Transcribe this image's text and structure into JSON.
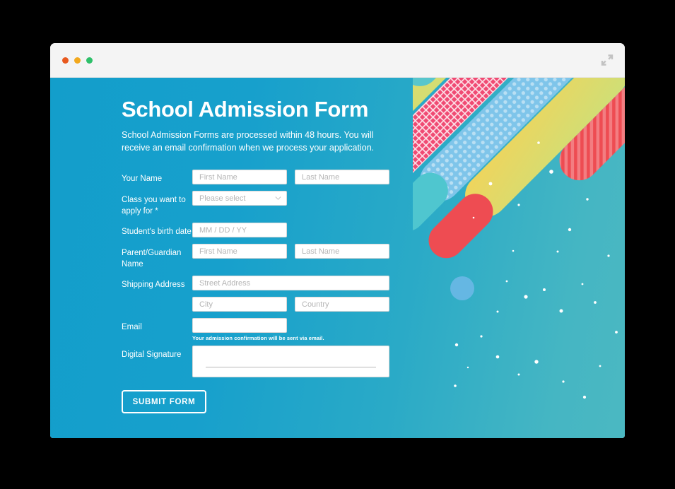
{
  "window": {
    "traffic_lights": [
      {
        "name": "close",
        "color": "#e8591f"
      },
      {
        "name": "minimize",
        "color": "#f2a81d"
      },
      {
        "name": "maximize",
        "color": "#2ec06a"
      }
    ],
    "expand_icon": "fullscreen-expand-icon"
  },
  "header": {
    "title": "School Admission Form",
    "subtitle": "School Admission Forms are processed within 48 hours. You will receive an email confirmation when we process your application."
  },
  "form": {
    "rows": [
      {
        "label": "Your Name",
        "fields": [
          {
            "name": "first-name-input",
            "placeholder": "First Name",
            "value": "",
            "width": "short"
          },
          {
            "name": "last-name-input",
            "placeholder": "Last Name",
            "value": "",
            "width": "short"
          }
        ]
      },
      {
        "label": "Class you want to apply for *",
        "fields": [
          {
            "name": "class-select",
            "placeholder": "Please select",
            "value": "",
            "width": "short",
            "type": "select"
          }
        ]
      },
      {
        "label": "Student's birth date",
        "fields": [
          {
            "name": "birth-date-input",
            "placeholder": "MM / DD / YY",
            "value": "",
            "width": "short"
          }
        ]
      },
      {
        "label": "Parent/Guardian Name",
        "fields": [
          {
            "name": "guardian-first-name-input",
            "placeholder": "First Name",
            "value": "",
            "width": "short"
          },
          {
            "name": "guardian-last-name-input",
            "placeholder": "Last Name",
            "value": "",
            "width": "short"
          }
        ]
      },
      {
        "label": "Shipping Address",
        "fields": [
          {
            "name": "street-address-input",
            "placeholder": "Street Address",
            "value": "",
            "width": "wide"
          }
        ]
      },
      {
        "label": "",
        "fields": [
          {
            "name": "city-input",
            "placeholder": "City",
            "value": "",
            "width": "short"
          },
          {
            "name": "country-input",
            "placeholder": "Country",
            "value": "",
            "width": "short"
          }
        ]
      },
      {
        "label": "Email",
        "helper": "Your admission confirmation will be sent via email.",
        "fields": [
          {
            "name": "email-input",
            "placeholder": "",
            "value": "",
            "width": "short"
          }
        ]
      },
      {
        "label": "Digital Signature",
        "fields": [
          {
            "name": "digital-signature-pad",
            "placeholder": "",
            "value": "",
            "width": "wide",
            "type": "signature"
          }
        ]
      }
    ],
    "submit_label": "SUBMIT FORM"
  },
  "colors": {
    "gradient_start": "#139ECB",
    "gradient_end": "#4BB8C2",
    "accent_pink": "#F04A73",
    "accent_yellow": "#F2C94C",
    "accent_lime": "#D6E06B",
    "accent_teal": "#4FC3CE",
    "accent_red": "#EE4C52",
    "accent_blue": "#6FB8E8",
    "white": "#FFFFFF"
  }
}
